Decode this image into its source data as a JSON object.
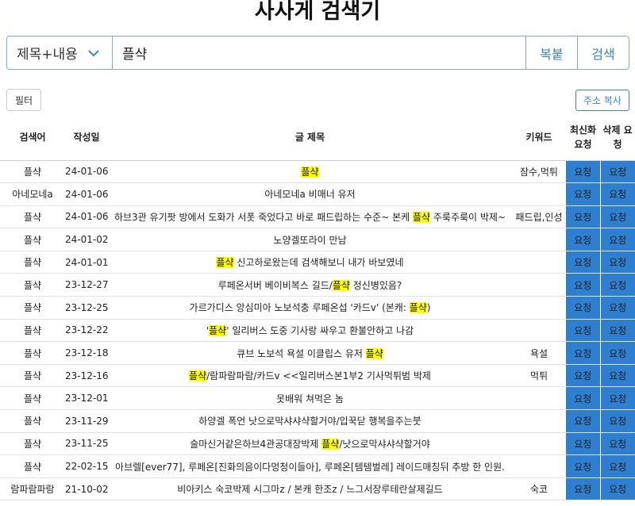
{
  "page_title": "사사게 검색기",
  "search": {
    "scope_label": "제목+내용",
    "query": "플샥",
    "paste_label": "복붙",
    "search_label": "검색"
  },
  "filter_label": "필터",
  "copy_address_label": "주소 복사",
  "highlight_color": "#ffff00",
  "accent_color": "#2f7fd0",
  "columns": {
    "keyword": "검색어",
    "date": "작성일",
    "title": "글 제목",
    "tags": "키워드",
    "refresh": "최신화 요청",
    "delete": "삭제 요청"
  },
  "rows": [
    {
      "keyword": "플샥",
      "date": "24-01-06",
      "title": [
        {
          "text": "플샥",
          "hl": true
        }
      ],
      "tags": "잠수,먹튀",
      "refresh": "요청",
      "delete": "요청"
    },
    {
      "keyword": "아네모네a",
      "date": "24-01-06",
      "title": [
        {
          "text": "아네모네a 비매너 유저",
          "hl": false
        }
      ],
      "tags": "",
      "refresh": "요청",
      "delete": "요청"
    },
    {
      "keyword": "플샥",
      "date": "24-01-06",
      "title": [
        {
          "text": "하브3관 유기팟 방에서 도화가 서폿 죽었다고 바로 패드립하는 수준~ 본케 ",
          "hl": false
        },
        {
          "text": "플샥",
          "hl": true
        },
        {
          "text": " 주룩주룩이 박제~",
          "hl": false
        }
      ],
      "tags": "패드립,인성",
      "refresh": "요청",
      "delete": "요청"
    },
    {
      "keyword": "플샥",
      "date": "24-01-02",
      "title": [
        {
          "text": "노양겔또라이 만남",
          "hl": false
        }
      ],
      "tags": "",
      "refresh": "요청",
      "delete": "요청"
    },
    {
      "keyword": "플샥",
      "date": "24-01-01",
      "title": [
        {
          "text": "플샥",
          "hl": true
        },
        {
          "text": " 신고하로왔는데 검색해보니 내가 바보였네",
          "hl": false
        }
      ],
      "tags": "",
      "refresh": "요청",
      "delete": "요청"
    },
    {
      "keyword": "플샥",
      "date": "23-12-27",
      "title": [
        {
          "text": "루페온서버 베이비복스 길드/",
          "hl": false
        },
        {
          "text": "플샥",
          "hl": true
        },
        {
          "text": " 정신병있음?",
          "hl": false
        }
      ],
      "tags": "",
      "refresh": "요청",
      "delete": "요청"
    },
    {
      "keyword": "플샥",
      "date": "23-12-25",
      "title": [
        {
          "text": "가르가디스 앙심미아 노보석충 루페온섭 '카드v' (본캐: ",
          "hl": false
        },
        {
          "text": "플샥",
          "hl": true
        },
        {
          "text": ")",
          "hl": false
        }
      ],
      "tags": "",
      "refresh": "요청",
      "delete": "요청"
    },
    {
      "keyword": "플샥",
      "date": "23-12-22",
      "title": [
        {
          "text": "'",
          "hl": false
        },
        {
          "text": "플샥",
          "hl": true
        },
        {
          "text": "' 일리버스 도중 기사랑 싸우고 환불안하고 나감",
          "hl": false
        }
      ],
      "tags": "",
      "refresh": "요청",
      "delete": "요청"
    },
    {
      "keyword": "플샥",
      "date": "23-12-18",
      "title": [
        {
          "text": "큐브 노보석 욕설 이클립스 유저 ",
          "hl": false
        },
        {
          "text": "플샥",
          "hl": true
        }
      ],
      "tags": "욕설",
      "refresh": "요청",
      "delete": "요청"
    },
    {
      "keyword": "플샥",
      "date": "23-12-16",
      "title": [
        {
          "text": "플샥",
          "hl": true
        },
        {
          "text": "/람파람파람/카드v <<일리버스본1부2 기사먹튀범 박제",
          "hl": false
        }
      ],
      "tags": "먹튀",
      "refresh": "요청",
      "delete": "요청"
    },
    {
      "keyword": "플샥",
      "date": "23-12-01",
      "title": [
        {
          "text": "못배워 쳐먹은 놈",
          "hl": false
        }
      ],
      "tags": "",
      "refresh": "요청",
      "delete": "요청"
    },
    {
      "keyword": "플샥",
      "date": "23-11-29",
      "title": [
        {
          "text": "하양겔 폭언 낫으로막샤샤샥할거야/입꾹닫 행복을주는붓",
          "hl": false
        }
      ],
      "tags": "",
      "refresh": "요청",
      "delete": "요청"
    },
    {
      "keyword": "플샥",
      "date": "23-11-25",
      "title": [
        {
          "text": "술마신거같은하브4관공대장박제 ",
          "hl": false
        },
        {
          "text": "플샥",
          "hl": true
        },
        {
          "text": "/낫으로막샤샤샥할거야",
          "hl": false
        }
      ],
      "tags": "",
      "refresh": "요청",
      "delete": "요청"
    },
    {
      "keyword": "플샥",
      "date": "22-02-15",
      "title": [
        {
          "text": "아브렐[ever77], 루페온[진화의음이다멍청이들아], 루페온[템템벌레] 레이드매칭뒤 추방 한 인원.",
          "hl": false
        }
      ],
      "tags": "",
      "refresh": "요청",
      "delete": "요청"
    },
    {
      "keyword": "람파람파람",
      "date": "21-10-02",
      "title": [
        {
          "text": "비아키스 숙코박제 시그마z / 본캐 한조z / 느그서장루테란살제길드",
          "hl": false
        }
      ],
      "tags": "숙코",
      "refresh": "요청",
      "delete": "요청"
    }
  ]
}
